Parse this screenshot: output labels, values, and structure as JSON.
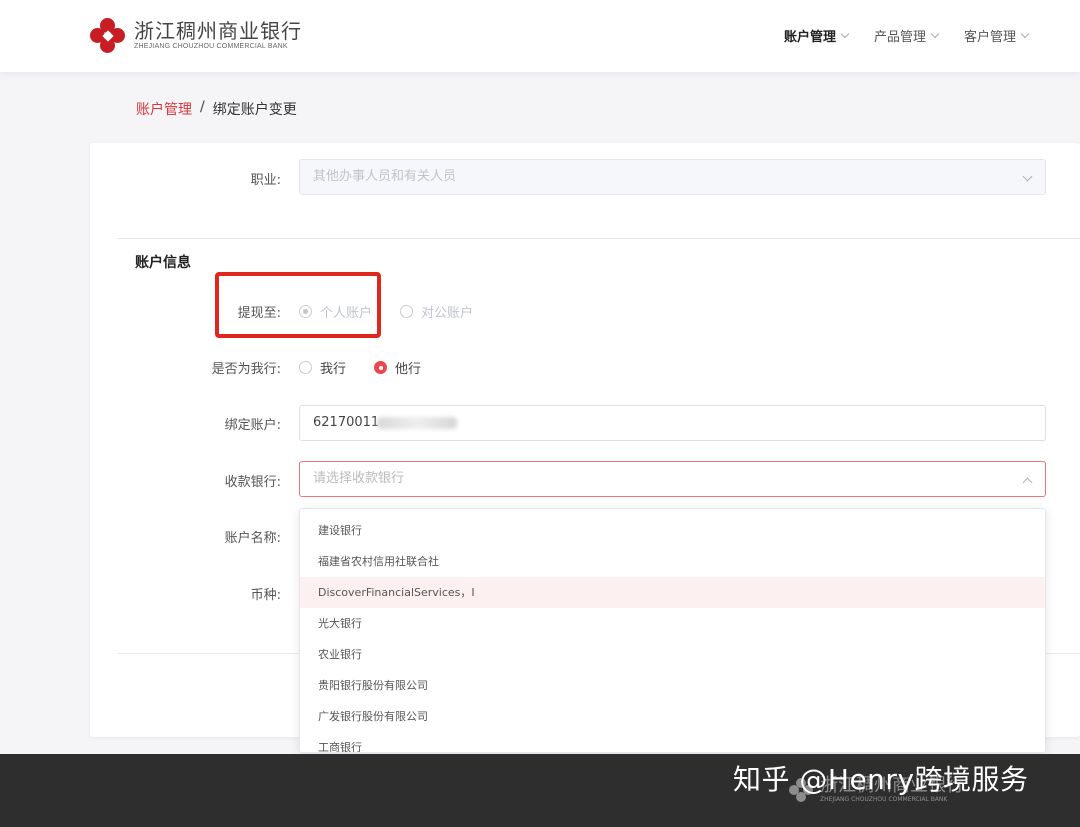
{
  "header": {
    "logo_cn": "浙江稠州商业银行",
    "logo_en": "ZHEJIANG CHOUZHOU COMMERCIAL BANK",
    "nav": [
      {
        "label": "账户管理"
      },
      {
        "label": "产品管理"
      },
      {
        "label": "客户管理"
      }
    ]
  },
  "breadcrumb": {
    "parent": "账户管理",
    "separator": "/",
    "current": "绑定账户变更"
  },
  "form": {
    "occupation_label": "职业:",
    "occupation_value": "其他办事人员和有关人员",
    "section_title": "账户信息",
    "withdraw_label": "提现至:",
    "withdraw_options": [
      "个人账户",
      "对公账户"
    ],
    "same_bank_label": "是否为我行:",
    "same_bank_options": [
      "我行",
      "他行"
    ],
    "bound_account_label": "绑定账户:",
    "bound_account_value": "62170011",
    "receiving_bank_label": "收款银行:",
    "receiving_bank_placeholder": "请选择收款银行",
    "account_name_label": "账户名称:",
    "currency_label": "币种:"
  },
  "dropdown": {
    "items": [
      "建设银行",
      "福建省农村信用社联合社",
      "DiscoverFinancialServices，I",
      "光大银行",
      "农业银行",
      "贵阳银行股份有限公司",
      "广发银行股份有限公司",
      "工商银行"
    ],
    "hovered_index": 2
  },
  "watermark": {
    "text": "知乎 @Henry跨境服务",
    "logo_cn": "浙江稠州商业银行",
    "logo_en": "ZHEJIANG CHOUZHOU COMMERCIAL BANK"
  },
  "colors": {
    "accent": "#d9363e",
    "highlight_box": "#e0261d"
  }
}
